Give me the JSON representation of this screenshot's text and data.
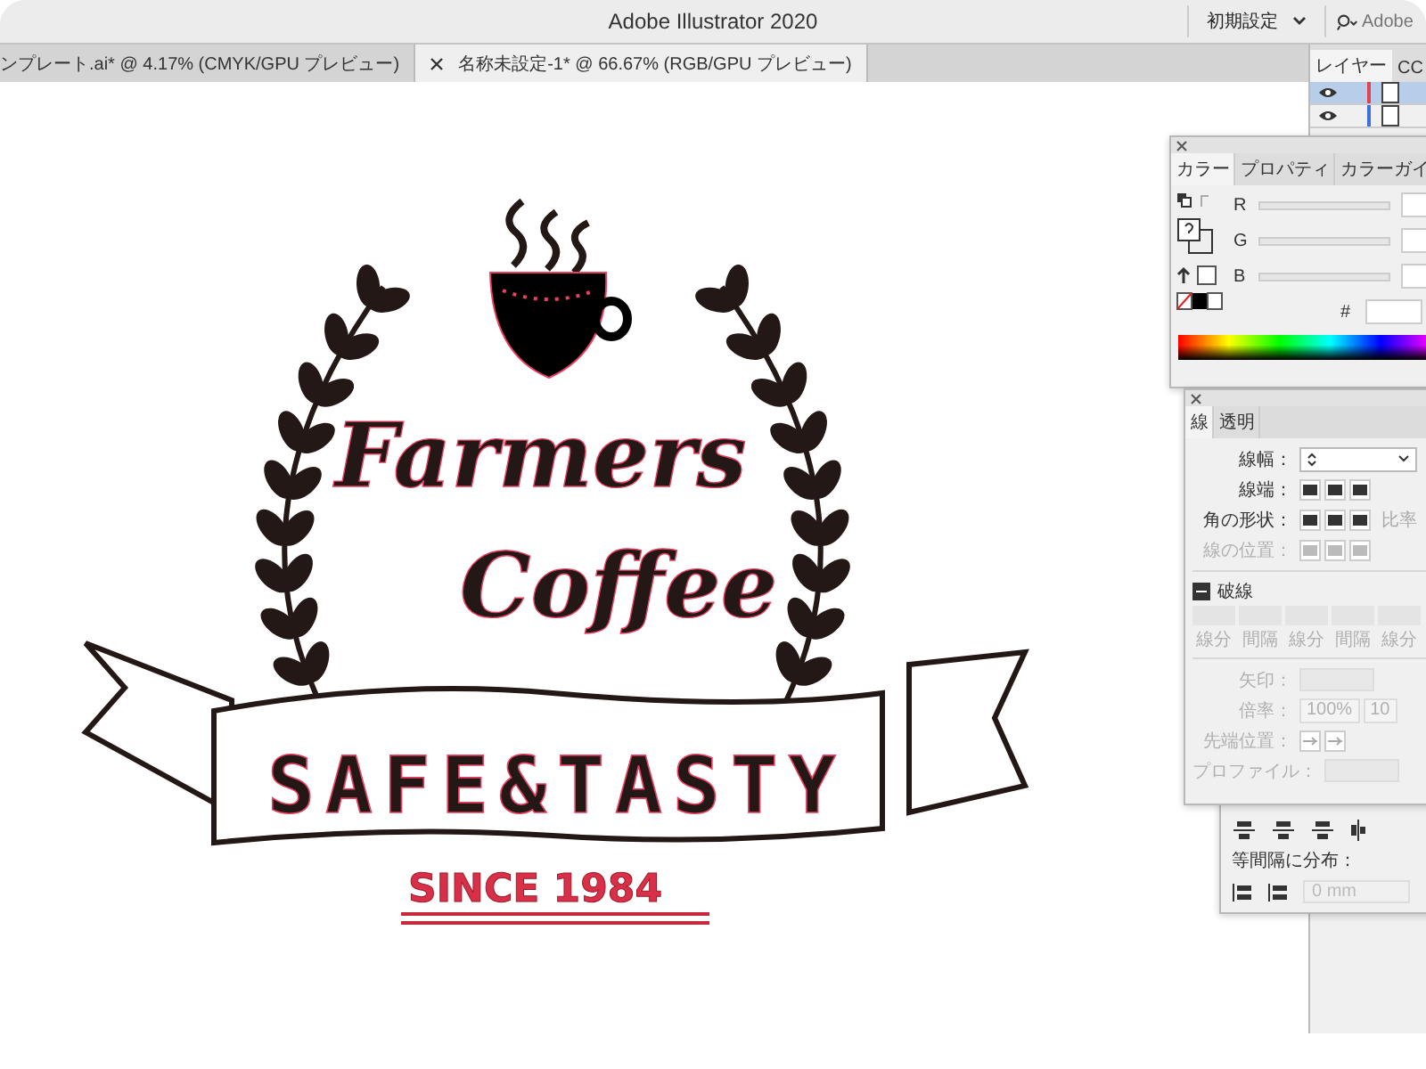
{
  "window": {
    "title": "Adobe Illustrator 2020",
    "workspace": "初期設定",
    "search_placeholder": "Adobe"
  },
  "document_tabs": [
    {
      "label": "ンプレート.ai* @ 4.17% (CMYK/GPU プレビュー)",
      "selected": false
    },
    {
      "label": "名称未設定-1* @ 66.67% (RGB/GPU プレビュー)",
      "selected": true
    }
  ],
  "layers_panel": {
    "tabs": [
      {
        "label": "レイヤー",
        "selected": true
      },
      {
        "label": "CC",
        "selected": false
      }
    ],
    "rows": [
      {
        "selected": true,
        "color": "#e0454f"
      },
      {
        "selected": false,
        "color": "#3d6fe0"
      }
    ]
  },
  "artwork": {
    "title_line_1": "Farmers",
    "title_line_2": "Coffee",
    "banner_text": "SAFE&TASTY",
    "since_text": "SINCE 1984"
  },
  "color_panel": {
    "tabs": [
      {
        "label": "カラー",
        "selected": true
      },
      {
        "label": "プロパティ",
        "selected": false
      },
      {
        "label": "カラーガイ",
        "selected": false
      }
    ],
    "channels": [
      {
        "label": "R"
      },
      {
        "label": "G"
      },
      {
        "label": "B"
      }
    ],
    "hex_label": "#"
  },
  "stroke_panel": {
    "tabs": [
      {
        "label": "線",
        "selected": true
      },
      {
        "label": "透明",
        "selected": false
      }
    ],
    "rows": [
      {
        "kind": "weight",
        "label": "線幅：",
        "disabled": false
      },
      {
        "kind": "icons",
        "label": "線端：",
        "disabled": false
      },
      {
        "kind": "icons",
        "label": "角の形状：",
        "disabled": false,
        "extra_label": "比率"
      },
      {
        "kind": "icons",
        "label": "線の位置：",
        "disabled": true
      }
    ],
    "dashed_label": "破線",
    "dash_labels": [
      "線分",
      "間隔",
      "線分",
      "間隔",
      "線分"
    ],
    "lower_rows": [
      {
        "kind": "dropdown",
        "label": "矢印：",
        "disabled": true
      },
      {
        "kind": "spin",
        "label": "倍率：",
        "values": [
          "100%",
          "10"
        ],
        "disabled": true
      },
      {
        "kind": "icons",
        "label": "先端位置：",
        "disabled": true
      },
      {
        "kind": "dropdown",
        "label": "プロファイル：",
        "disabled": true
      }
    ]
  },
  "align_panel": {
    "distribute_label": "等間隔に分布：",
    "spacing_value": "0 mm"
  }
}
